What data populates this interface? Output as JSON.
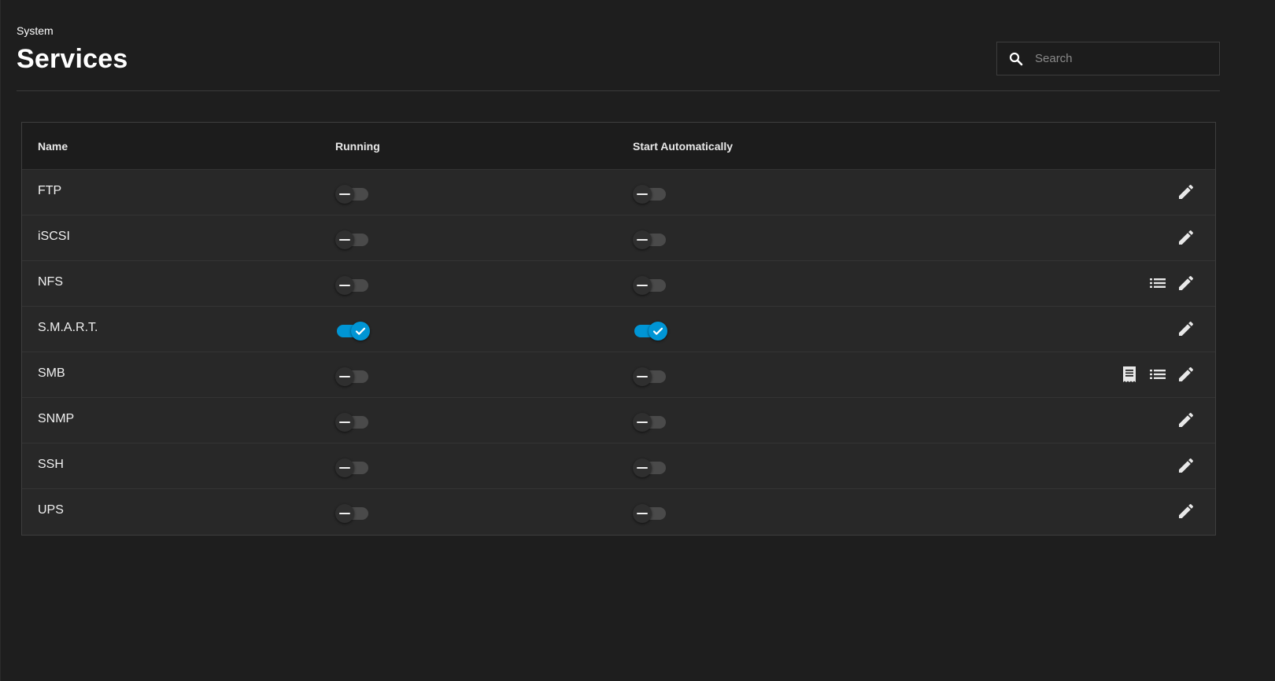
{
  "header": {
    "breadcrumb": "System",
    "title": "Services"
  },
  "search": {
    "placeholder": "Search",
    "value": "",
    "icon": "search-icon"
  },
  "table": {
    "columns": {
      "name": "Name",
      "running": "Running",
      "start_automatically": "Start Automatically"
    },
    "rows": [
      {
        "name": "FTP",
        "running": false,
        "start_automatically": false,
        "actions": [
          "edit"
        ]
      },
      {
        "name": "iSCSI",
        "running": false,
        "start_automatically": false,
        "actions": [
          "edit"
        ]
      },
      {
        "name": "NFS",
        "running": false,
        "start_automatically": false,
        "actions": [
          "list",
          "edit"
        ]
      },
      {
        "name": "S.M.A.R.T.",
        "running": true,
        "start_automatically": true,
        "actions": [
          "edit"
        ]
      },
      {
        "name": "SMB",
        "running": false,
        "start_automatically": false,
        "actions": [
          "receipt",
          "list",
          "edit"
        ]
      },
      {
        "name": "SNMP",
        "running": false,
        "start_automatically": false,
        "actions": [
          "edit"
        ]
      },
      {
        "name": "SSH",
        "running": false,
        "start_automatically": false,
        "actions": [
          "edit"
        ]
      },
      {
        "name": "UPS",
        "running": false,
        "start_automatically": false,
        "actions": [
          "edit"
        ]
      }
    ]
  },
  "colors": {
    "background": "#1e1e1e",
    "row": "#282828",
    "header_row": "#1c1c1c",
    "accent": "#0095d5",
    "toggle_off_track": "#4a4a4a"
  }
}
